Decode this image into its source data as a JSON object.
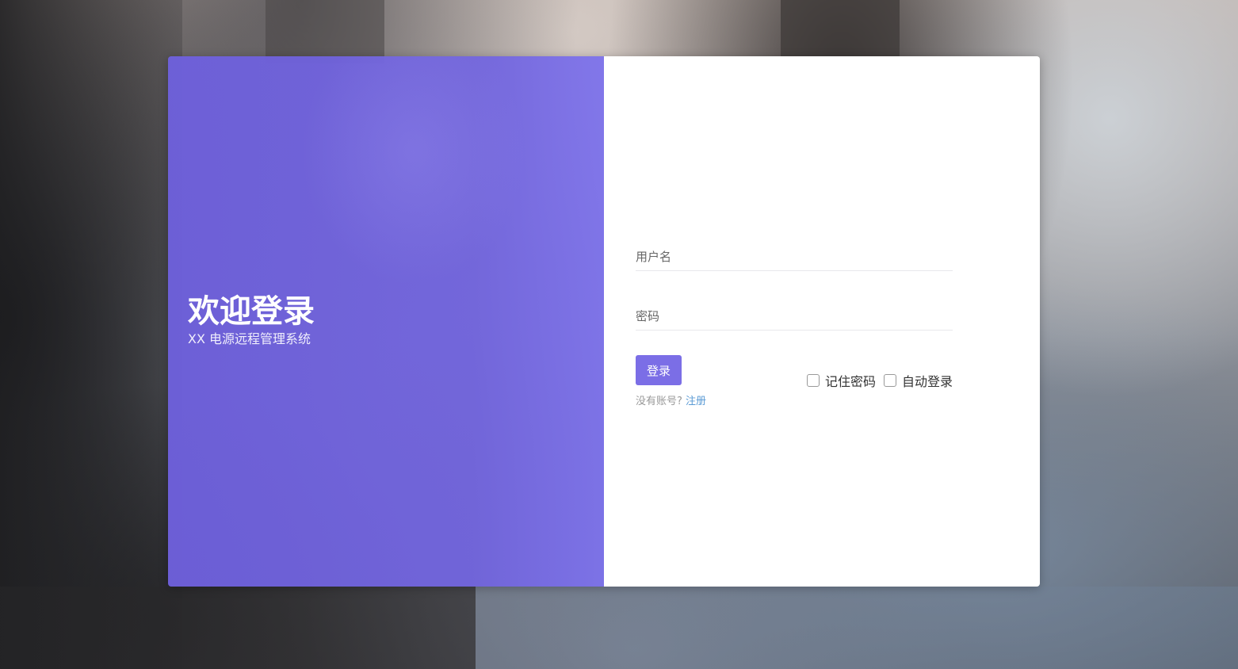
{
  "welcome": {
    "title": "欢迎登录",
    "subtitle": "XX 电源远程管理系统"
  },
  "form": {
    "username_placeholder": "用户名",
    "password_placeholder": "密码",
    "login_label": "登录",
    "remember_password_label": "记住密码",
    "remember_password_checked": false,
    "auto_login_label": "自动登录",
    "auto_login_checked": false,
    "no_account_text": "没有账号?",
    "register_label": "注册"
  },
  "colors": {
    "accent": "#7b6ee6",
    "left_panel": "#7165dd",
    "link": "#5b9bd5"
  }
}
